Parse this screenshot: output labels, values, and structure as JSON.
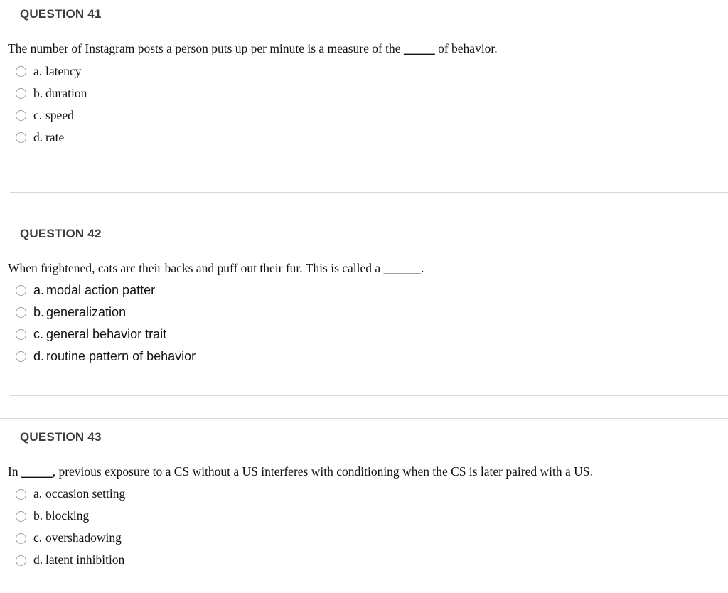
{
  "page": {
    "background_color": "#ffffff",
    "heading_color": "#3c3c3c",
    "text_color": "#111111",
    "separator_color": "#d8d8d8",
    "radio_border_color": "#a0a0a0"
  },
  "questions": [
    {
      "heading": "QUESTION 41",
      "stem_before": "The number of Instagram posts a person puts up per minute is a measure of the",
      "blank": "_____",
      "stem_after": "of behavior.",
      "options": [
        {
          "letter": "a.",
          "text": "latency"
        },
        {
          "letter": "b.",
          "text": "duration"
        },
        {
          "letter": "c.",
          "text": "speed"
        },
        {
          "letter": "d.",
          "text": "rate"
        }
      ]
    },
    {
      "heading": "QUESTION 42",
      "stem_before": "When frightened, cats arc their backs and puff out their fur.  This is called a",
      "blank": "______",
      "stem_after": ".",
      "options": [
        {
          "letter": "a.",
          "text": "modal action patter"
        },
        {
          "letter": "b.",
          "text": "generalization"
        },
        {
          "letter": "c.",
          "text": "general behavior trait"
        },
        {
          "letter": "d.",
          "text": "routine pattern of behavior"
        }
      ]
    },
    {
      "heading": "QUESTION 43",
      "stem_before": "In",
      "blank": "_____",
      "stem_after": ",  previous exposure to a CS without a US interferes with conditioning when the CS is later paired with a US.",
      "options": [
        {
          "letter": "a.",
          "text": "occasion setting"
        },
        {
          "letter": "b.",
          "text": "blocking"
        },
        {
          "letter": "c.",
          "text": "overshadowing"
        },
        {
          "letter": "d.",
          "text": "latent inhibition"
        }
      ]
    }
  ]
}
